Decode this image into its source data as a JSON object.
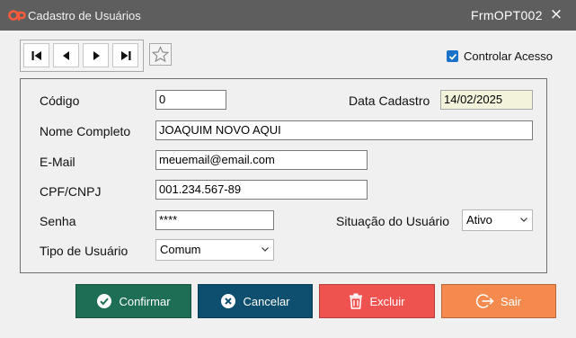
{
  "window": {
    "title": "Cadastro de Usuários",
    "form_code": "FrmOPT002",
    "close_glyph": "×"
  },
  "nav": {
    "buttons": [
      "first-record-icon",
      "previous-record-icon",
      "next-record-icon",
      "last-record-icon"
    ],
    "favorite_icon": "star-icon"
  },
  "options": {
    "controlar_acesso_label": "Controlar Acesso",
    "controlar_acesso_checked": true
  },
  "form": {
    "codigo_label": "Código",
    "codigo_value": "0",
    "data_cadastro_label": "Data Cadastro",
    "data_cadastro_value": "14/02/2025",
    "nome_label": "Nome Completo",
    "nome_value": "JOAQUIM NOVO AQUI",
    "email_label": "E-Mail",
    "email_value": "meuemail@email.com",
    "cpf_label": "CPF/CNPJ",
    "cpf_value": "001.234.567-89",
    "senha_label": "Senha",
    "senha_value": "****",
    "situacao_label": "Situação do Usuário",
    "situacao_value": "Ativo",
    "tipo_label": "Tipo de Usuário",
    "tipo_value": "Comum"
  },
  "actions": {
    "confirmar": "Confirmar",
    "cancelar": "Cancelar",
    "excluir": "Excluir",
    "sair": "Sair"
  },
  "colors": {
    "titlebar": "#5e5e5e",
    "confirmar": "#1e6e55",
    "cancelar": "#0e4e6e",
    "excluir": "#ef5350",
    "sair": "#f58a4f",
    "checkbox": "#1a73c8"
  }
}
